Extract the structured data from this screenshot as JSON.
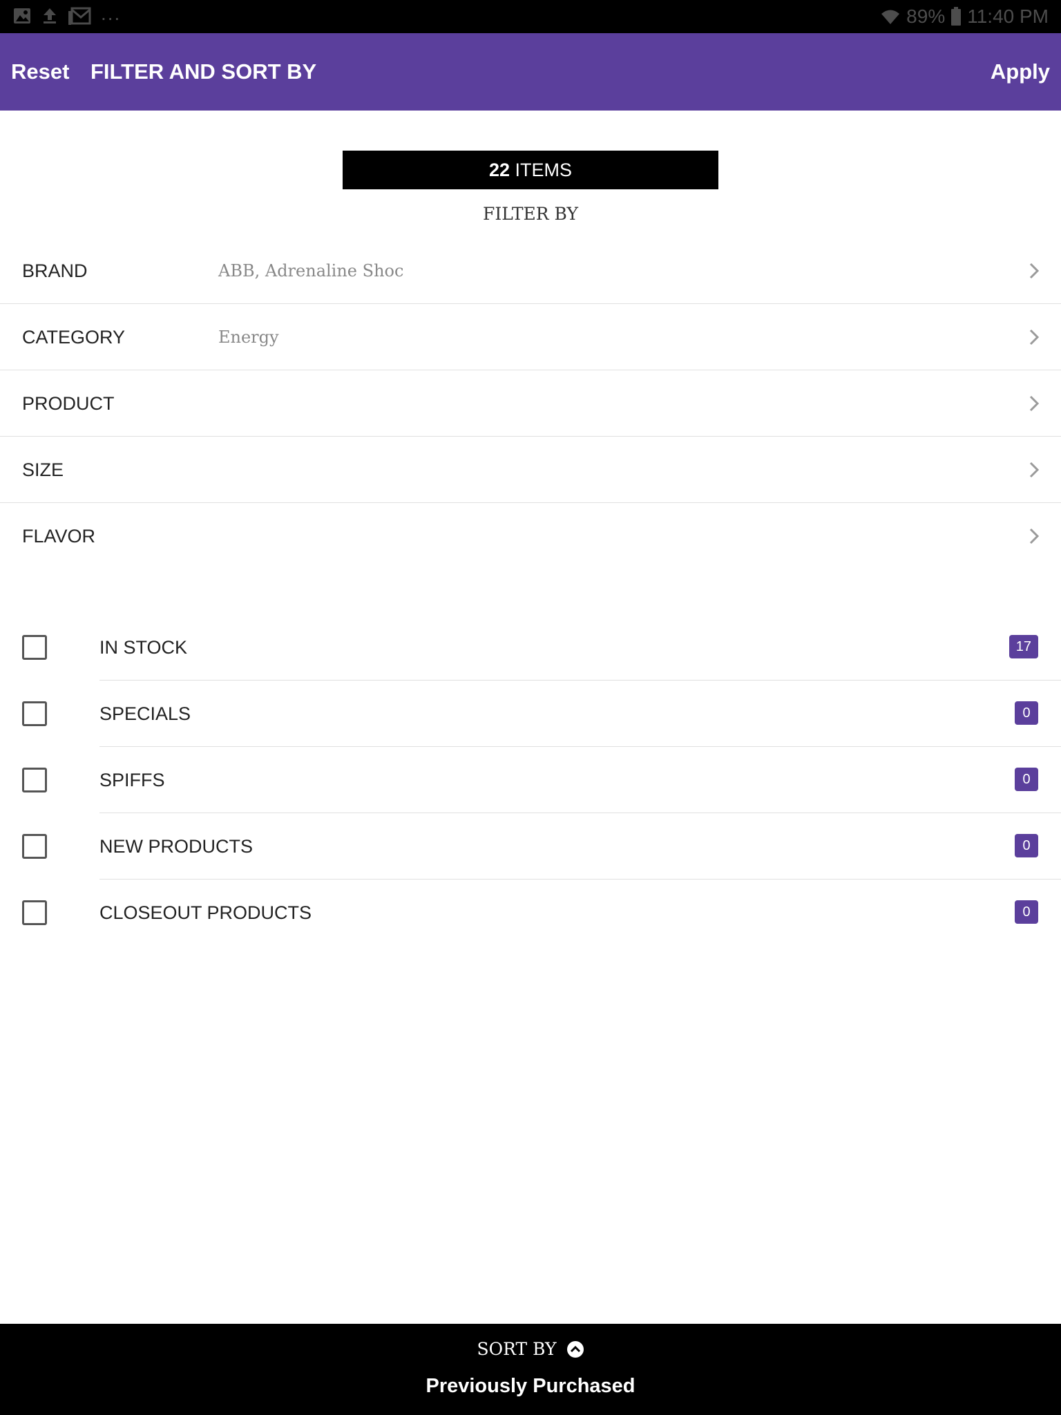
{
  "status_bar": {
    "left_icons": [
      "image-icon",
      "upload-icon",
      "mail-icon"
    ],
    "overflow": "...",
    "battery": "89%",
    "time": "11:40 PM"
  },
  "app_bar": {
    "reset_label": "Reset",
    "title": "FILTER AND SORT BY",
    "apply_label": "Apply",
    "background_color": "#5b3f9c"
  },
  "items": {
    "count": "22",
    "label": "ITEMS"
  },
  "filter_heading": "FILTER BY",
  "filters": [
    {
      "label": "BRAND",
      "value": "ABB, Adrenaline Shoc"
    },
    {
      "label": "CATEGORY",
      "value": "Energy"
    },
    {
      "label": "PRODUCT",
      "value": ""
    },
    {
      "label": "SIZE",
      "value": ""
    },
    {
      "label": "FLAVOR",
      "value": ""
    }
  ],
  "toggles": [
    {
      "label": "IN STOCK",
      "count": "17",
      "checked": false
    },
    {
      "label": "SPECIALS",
      "count": "0",
      "checked": false
    },
    {
      "label": "SPIFFS",
      "count": "0",
      "checked": false
    },
    {
      "label": "NEW PRODUCTS",
      "count": "0",
      "checked": false
    },
    {
      "label": "CLOSEOUT PRODUCTS",
      "count": "0",
      "checked": false
    }
  ],
  "sort": {
    "label": "SORT BY",
    "value": "Previously Purchased"
  }
}
